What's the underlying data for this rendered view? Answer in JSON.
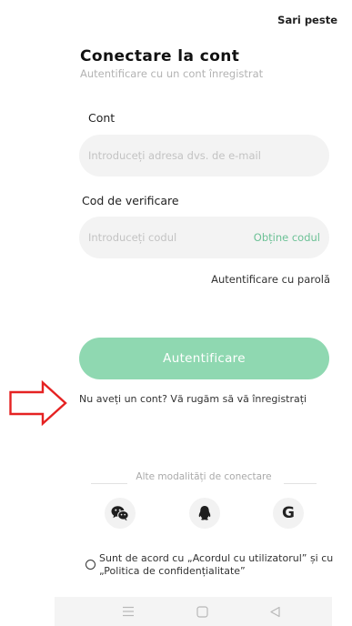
{
  "header": {
    "skip_label": "Sari peste"
  },
  "login": {
    "title": "Conectare la cont",
    "subtitle": "Autentificare cu un cont înregistrat",
    "account_label": "Cont",
    "email_placeholder": "Introduceți adresa dvs. de e-mail",
    "code_label": "Cod de verificare",
    "code_placeholder": "Introduceți codul",
    "get_code_label": "Obține codul",
    "password_login_link": "Autentificare cu parolă",
    "submit_label": "Autentificare",
    "register_link": "Nu aveți un cont? Vă rugăm să vă înregistrați"
  },
  "other_login": {
    "label": "Alte modalități de conectare",
    "methods": [
      {
        "icon": "wechat-icon"
      },
      {
        "icon": "qq-icon"
      },
      {
        "icon": "google-icon",
        "glyph": "G"
      }
    ]
  },
  "agreement": {
    "line1": "Sunt de acord cu „Acordul cu utilizatorul” și cu",
    "line2": "„Politica de confidențialitate”"
  },
  "navbar": {
    "icons": [
      "menu-icon",
      "home-icon",
      "back-icon"
    ]
  },
  "colors": {
    "accent": "#6cc196",
    "button": "#8fd8b1",
    "field_bg": "#f3f3f3",
    "annotation_arrow": "#e52222"
  }
}
